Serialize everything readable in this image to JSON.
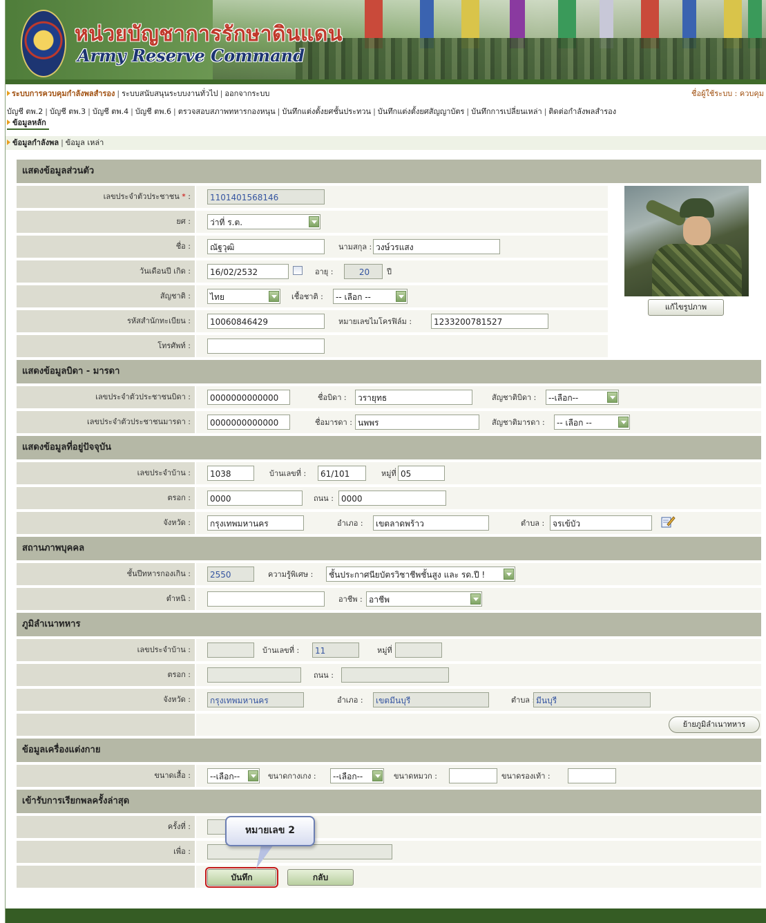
{
  "header": {
    "title_th": "หน่วยบัญชาการรักษาดินแดน",
    "title_en": "Army Reserve Command"
  },
  "nav1": {
    "items": [
      "ระบบการควบคุมกำลังพลสำรอง",
      "ระบบสนับสนุนระบบงานทั่วไป",
      "ออกจากระบบ"
    ],
    "user_label": "ชื่อผู้ใช้ระบบ : ควบคุม"
  },
  "nav2": {
    "items": [
      "บัญชี ตพ.2",
      "บัญชี ตพ.3",
      "บัญชี ตพ.4",
      "บัญชี ตพ.6",
      "ตรวจสอบสภาพทหารกองหนุน",
      "บันทึกแต่งตั้งยศชั้นประทวน",
      "บันทึกแต่งตั้งยศสัญญาบัตร",
      "บันทึกการเปลี่ยนเหล่า",
      "ติดต่อกำลังพลสำรอง"
    ],
    "active": "ข้อมูลหลัก"
  },
  "nav3": {
    "items": [
      "ข้อมูลกำลังพล",
      "ข้อมูล เหล่า"
    ]
  },
  "personal": {
    "section": "แสดงข้อมูลส่วนตัว",
    "id_label": "เลขประจำตัวประชาชน",
    "id_value": "1101401568146",
    "rank_label": "ยศ",
    "rank_value": "ว่าที่ ร.ต.",
    "name_label": "ชื่อ",
    "name_value": "ณัฐวุฒิ",
    "surname_label": "นามสกุล",
    "surname_value": "วงษ์วรแสง",
    "dob_label": "วันเดือนปี เกิด",
    "dob_value": "16/02/2532",
    "age_label": "อายุ",
    "age_value": "20",
    "age_unit": "ปี",
    "nationality_label": "สัญชาติ",
    "nationality_value": "ไทย",
    "race_label": "เชื้อชาติ",
    "race_value": "-- เลือก --",
    "house_reg_label": "รหัสสำนักทะเบียน",
    "house_reg_value": "10060846429",
    "microfilm_label": "หมายเลขไมโครฟิล์ม",
    "microfilm_value": "1233200781527",
    "phone_label": "โทรศัพท์",
    "phone_value": "",
    "edit_photo_button": "แก้ไขรูปภาพ"
  },
  "parents": {
    "section": "แสดงข้อมูลบิดา - มารดา",
    "father_id_label": "เลขประจำตัวประชาชนบิดา",
    "father_id_value": "0000000000000",
    "father_name_label": "ชื่อบิดา",
    "father_name_value": "วรายุทธ",
    "father_nat_label": "สัญชาติบิดา",
    "father_nat_value": "--เลือก--",
    "mother_id_label": "เลขประจำตัวประชาชนมารดา",
    "mother_id_value": "0000000000000",
    "mother_name_label": "ชื่อมารดา",
    "mother_name_value": "นพพร",
    "mother_nat_label": "สัญชาติมารดา",
    "mother_nat_value": "-- เลือก --"
  },
  "address": {
    "section": "แสดงข้อมูลที่อยู่ปัจจุบัน",
    "house_id_label": "เลขประจำบ้าน",
    "house_id_value": "1038",
    "house_no_label": "บ้านเลขที่",
    "house_no_value": "61/101",
    "moo_label": "หมู่ที่",
    "moo_value": "05",
    "soi_label": "ตรอก",
    "soi_value": "0000",
    "road_label": "ถนน",
    "road_value": "0000",
    "province_label": "จังหวัด",
    "province_value": "กรุงเทพมหานคร",
    "district_label": "อำเภอ",
    "district_value": "เขตลาดพร้าว",
    "subdistrict_label": "ตำบล",
    "subdistrict_value": "จรเข้บัว"
  },
  "status": {
    "section": "สถานภาพบุคคล",
    "year_label": "ชั้นปีทหารกองเกิน",
    "year_value": "2550",
    "skill_label": "ความรู้พิเศษ",
    "skill_value": "ชั้นประกาศนียบัตรวิชาชีพชั้นสูง และ รด.ปี !",
    "scar_label": "ตำหนิ",
    "scar_value": "",
    "occupation_label": "อาชีพ",
    "occupation_value": "อาชีพ"
  },
  "domicile": {
    "section": "ภูมิลำเนาทหาร",
    "house_id_label": "เลขประจำบ้าน",
    "house_id_value": "",
    "house_no_label": "บ้านเลขที่",
    "house_no_value": "11",
    "moo_label": "หมู่ที่",
    "moo_value": "",
    "soi_label": "ตรอก",
    "soi_value": "",
    "road_label": "ถนน",
    "road_value": "",
    "province_label": "จังหวัด",
    "province_value": "กรุงเทพมหานคร",
    "district_label": "อำเภอ",
    "district_value": "เขตมีนบุรี",
    "subdistrict_label": "ตำบล",
    "subdistrict_value": "มีนบุรี",
    "move_button": "ย้ายภูมิลำเนาทหาร"
  },
  "uniform": {
    "section": "ข้อมูลเครื่องแต่งกาย",
    "shirt_label": "ขนาดเสื้อ",
    "shirt_value": "--เลือก--",
    "pants_label": "ขนาดกางเกง",
    "pants_value": "--เลือก--",
    "hat_label": "ขนาดหมวก",
    "hat_value": "",
    "shoe_label": "ขนาดรองเท้า",
    "shoe_value": ""
  },
  "callup": {
    "section": "เข้ารับการเรียกพลครั้งล่าสุด",
    "times_label": "ครั้งที่",
    "times_value": "",
    "purpose_label": "เพื่อ",
    "purpose_value": ""
  },
  "actions": {
    "save": "บันทึก",
    "back": "กลับ"
  },
  "callout": "หมายเลข 2",
  "colors": {
    "header_green": "#3f6a2a",
    "highlight_red": "#c21818",
    "section_bg": "#b5b8a6"
  }
}
